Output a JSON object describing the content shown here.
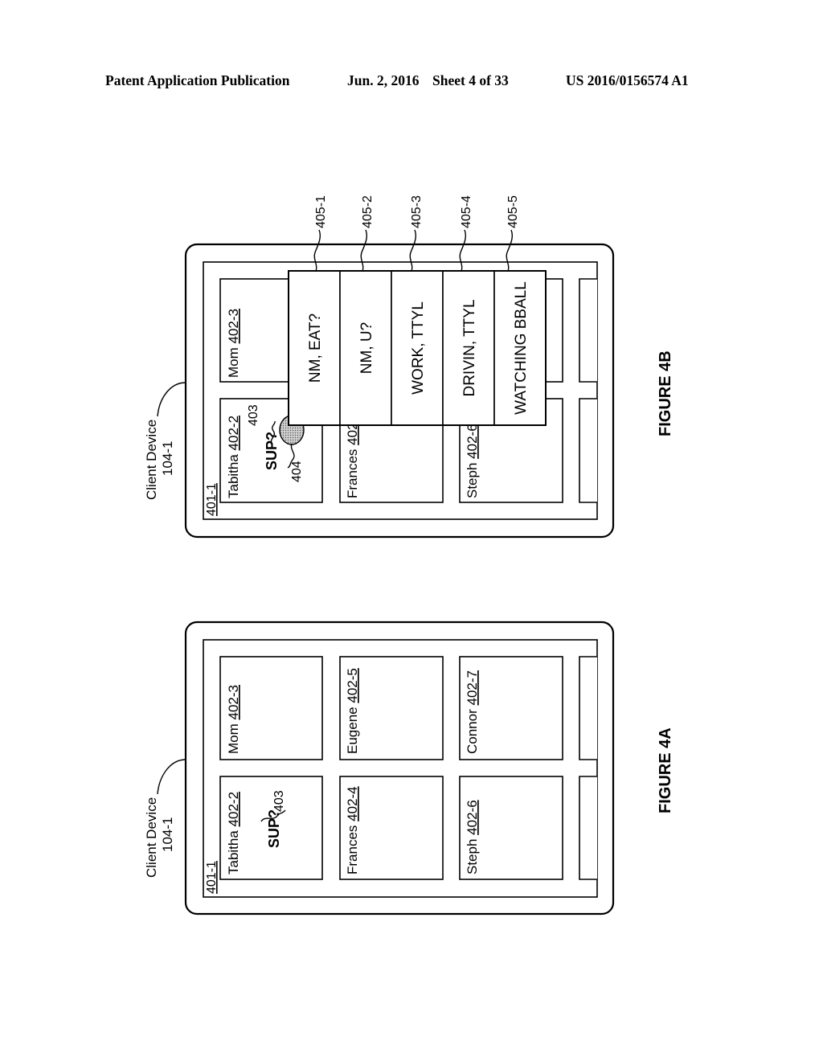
{
  "header": {
    "publication": "Patent Application Publication",
    "date": "Jun. 2, 2016",
    "sheet": "Sheet 4 of 33",
    "number": "US 2016/0156574 A1"
  },
  "figure_4b": {
    "caption": "FIGURE 4B",
    "device_label": "Client Device",
    "device_ref": "104-1",
    "screen_ref": "401-1",
    "tiles": [
      {
        "name": "Tabitha",
        "ref": "402-2"
      },
      {
        "name": "Mom",
        "ref": "402-3"
      },
      {
        "name": "Frances",
        "ref": "402"
      },
      {
        "name": "Steph",
        "ref": "402-6"
      }
    ],
    "message": {
      "text": "SUP?",
      "ref": "403"
    },
    "touch_ref": "404",
    "replies": [
      {
        "text": "NM, EAT?",
        "ref": "405-1"
      },
      {
        "text": "NM, U?",
        "ref": "405-2"
      },
      {
        "text": "WORK, TTYL",
        "ref": "405-3"
      },
      {
        "text": "DRIVIN, TTYL",
        "ref": "405-4"
      },
      {
        "text": "WATCHING BBALL",
        "ref": "405-5"
      }
    ]
  },
  "figure_4a": {
    "caption": "FIGURE 4A",
    "device_label": "Client Device",
    "device_ref": "104-1",
    "screen_ref": "401-1",
    "tiles": [
      {
        "name": "Tabitha",
        "ref": "402-2"
      },
      {
        "name": "Mom",
        "ref": "402-3"
      },
      {
        "name": "Frances",
        "ref": "402-4"
      },
      {
        "name": "Eugene",
        "ref": "402-5"
      },
      {
        "name": "Steph",
        "ref": "402-6"
      },
      {
        "name": "Connor",
        "ref": "402-7"
      }
    ],
    "message": {
      "text": "SUP?",
      "ref": "403"
    }
  }
}
